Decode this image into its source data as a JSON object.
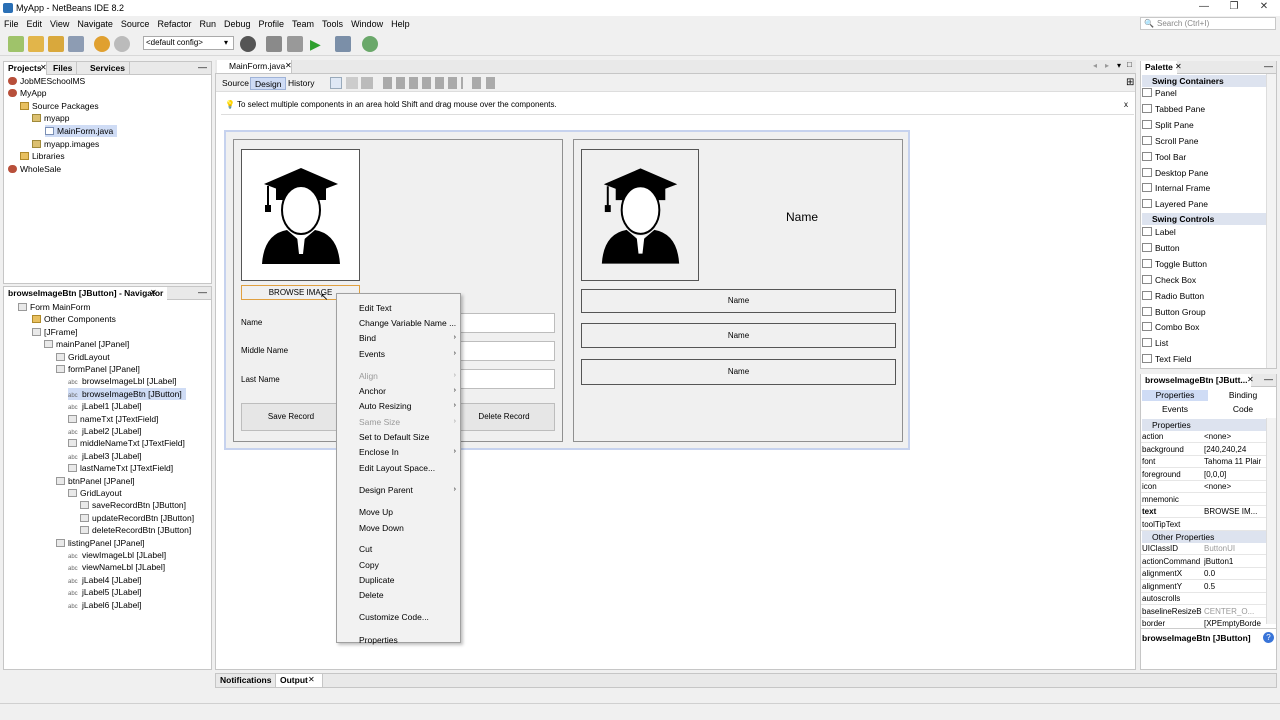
{
  "window": {
    "title": "MyApp - NetBeans IDE 8.2"
  },
  "menu": [
    "File",
    "Edit",
    "View",
    "Navigate",
    "Source",
    "Refactor",
    "Run",
    "Debug",
    "Profile",
    "Team",
    "Tools",
    "Window",
    "Help"
  ],
  "search": {
    "placeholder": "Search (Ctrl+I)"
  },
  "toolbar": {
    "config": "<default config>"
  },
  "projects": {
    "tabs": [
      "Projects",
      "Files",
      "Services"
    ],
    "tree": [
      "JobMESchoolMS",
      "MyApp",
      "Source Packages",
      "myapp",
      "MainForm.java",
      "myapp.images",
      "Libraries",
      "WholeSale"
    ]
  },
  "navigator": {
    "title": "browseImageBtn [JButton] - Navigator",
    "tree": [
      "Form MainForm",
      "Other Components",
      "[JFrame]",
      "mainPanel [JPanel]",
      "GridLayout",
      "formPanel [JPanel]",
      "browseImageLbl [JLabel]",
      "browseImageBtn [JButton]",
      "jLabel1 [JLabel]",
      "nameTxt [JTextField]",
      "jLabel2 [JLabel]",
      "middleNameTxt [JTextField]",
      "jLabel3 [JLabel]",
      "lastNameTxt [JTextField]",
      "btnPanel [JPanel]",
      "GridLayout",
      "saveRecordBtn [JButton]",
      "updateRecordBtn [JButton]",
      "deleteRecordBtn [JButton]",
      "listingPanel [JPanel]",
      "viewImageLbl [JLabel]",
      "viewNameLbl [JLabel]",
      "jLabel4 [JLabel]",
      "jLabel5 [JLabel]",
      "jLabel6 [JLabel]"
    ]
  },
  "editor": {
    "file_tab": "MainForm.java",
    "views": [
      "Source",
      "Design",
      "History"
    ],
    "hint": "To select multiple components in an area hold Shift and drag mouse over the components."
  },
  "form": {
    "browse_button": "BROWSE IMAGE",
    "labels": [
      "Name",
      "Middle Name",
      "Last Name"
    ],
    "save_button": "Save Record",
    "delete_button": "Delete Record",
    "view_name": "Name",
    "name_rows": [
      "Name",
      "Name",
      "Name"
    ]
  },
  "context_menu": {
    "items": [
      {
        "label": "Edit Text",
        "sub": false,
        "disabled": false
      },
      {
        "label": "Change Variable Name ...",
        "sub": false,
        "disabled": false
      },
      {
        "label": "Bind",
        "sub": true,
        "disabled": false
      },
      {
        "label": "Events",
        "sub": true,
        "disabled": false
      },
      {
        "label": "Align",
        "sub": true,
        "disabled": true
      },
      {
        "label": "Anchor",
        "sub": true,
        "disabled": false
      },
      {
        "label": "Auto Resizing",
        "sub": true,
        "disabled": false
      },
      {
        "label": "Same Size",
        "sub": true,
        "disabled": true
      },
      {
        "label": "Set to Default Size",
        "sub": false,
        "disabled": false
      },
      {
        "label": "Enclose In",
        "sub": true,
        "disabled": false
      },
      {
        "label": "Edit Layout Space...",
        "sub": false,
        "disabled": false
      },
      {
        "label": "Design Parent",
        "sub": true,
        "disabled": false
      },
      {
        "label": "Move Up",
        "sub": false,
        "disabled": false
      },
      {
        "label": "Move Down",
        "sub": false,
        "disabled": false
      },
      {
        "label": "Cut",
        "sub": false,
        "disabled": false
      },
      {
        "label": "Copy",
        "sub": false,
        "disabled": false
      },
      {
        "label": "Duplicate",
        "sub": false,
        "disabled": false
      },
      {
        "label": "Delete",
        "sub": false,
        "disabled": false
      },
      {
        "label": "Customize Code...",
        "sub": false,
        "disabled": false
      },
      {
        "label": "Properties",
        "sub": false,
        "disabled": false
      }
    ]
  },
  "palette": {
    "title": "Palette",
    "containers_header": "Swing Containers",
    "containers": [
      "Panel",
      "Tabbed Pane",
      "Split Pane",
      "Scroll Pane",
      "Tool Bar",
      "Desktop Pane",
      "Internal Frame",
      "Layered Pane"
    ],
    "controls_header": "Swing Controls",
    "controls": [
      "Label",
      "Button",
      "Toggle Button",
      "Check Box",
      "Radio Button",
      "Button Group",
      "Combo Box",
      "List",
      "Text Field"
    ]
  },
  "properties": {
    "title": "browseImageBtn [JButt...",
    "tabs": [
      "Properties",
      "Binding",
      "Events",
      "Code"
    ],
    "section_props": "Properties",
    "rows": [
      {
        "k": "action",
        "v": "<none>"
      },
      {
        "k": "background",
        "v": "[240,240,24"
      },
      {
        "k": "font",
        "v": "Tahoma 11 Plair"
      },
      {
        "k": "foreground",
        "v": "[0,0,0]"
      },
      {
        "k": "icon",
        "v": "<none>"
      },
      {
        "k": "mnemonic",
        "v": ""
      },
      {
        "k": "text",
        "v": "BROWSE IM..."
      },
      {
        "k": "toolTipText",
        "v": ""
      }
    ],
    "section_other": "Other Properties",
    "other_rows": [
      {
        "k": "UIClassID",
        "v": "ButtonUI"
      },
      {
        "k": "actionCommand",
        "v": "jButton1"
      },
      {
        "k": "alignmentX",
        "v": "0.0"
      },
      {
        "k": "alignmentY",
        "v": "0.5"
      },
      {
        "k": "autoscrolls",
        "v": ""
      },
      {
        "k": "baselineResizeBeh",
        "v": "CENTER_O..."
      },
      {
        "k": "border",
        "v": "[XPEmptyBorde"
      }
    ],
    "footer": "browseImageBtn [JButton]"
  },
  "bottom": {
    "tabs": [
      "Notifications",
      "Output"
    ]
  },
  "colors": {
    "selection": "#cfdcf5",
    "accent": "#3874d8"
  }
}
